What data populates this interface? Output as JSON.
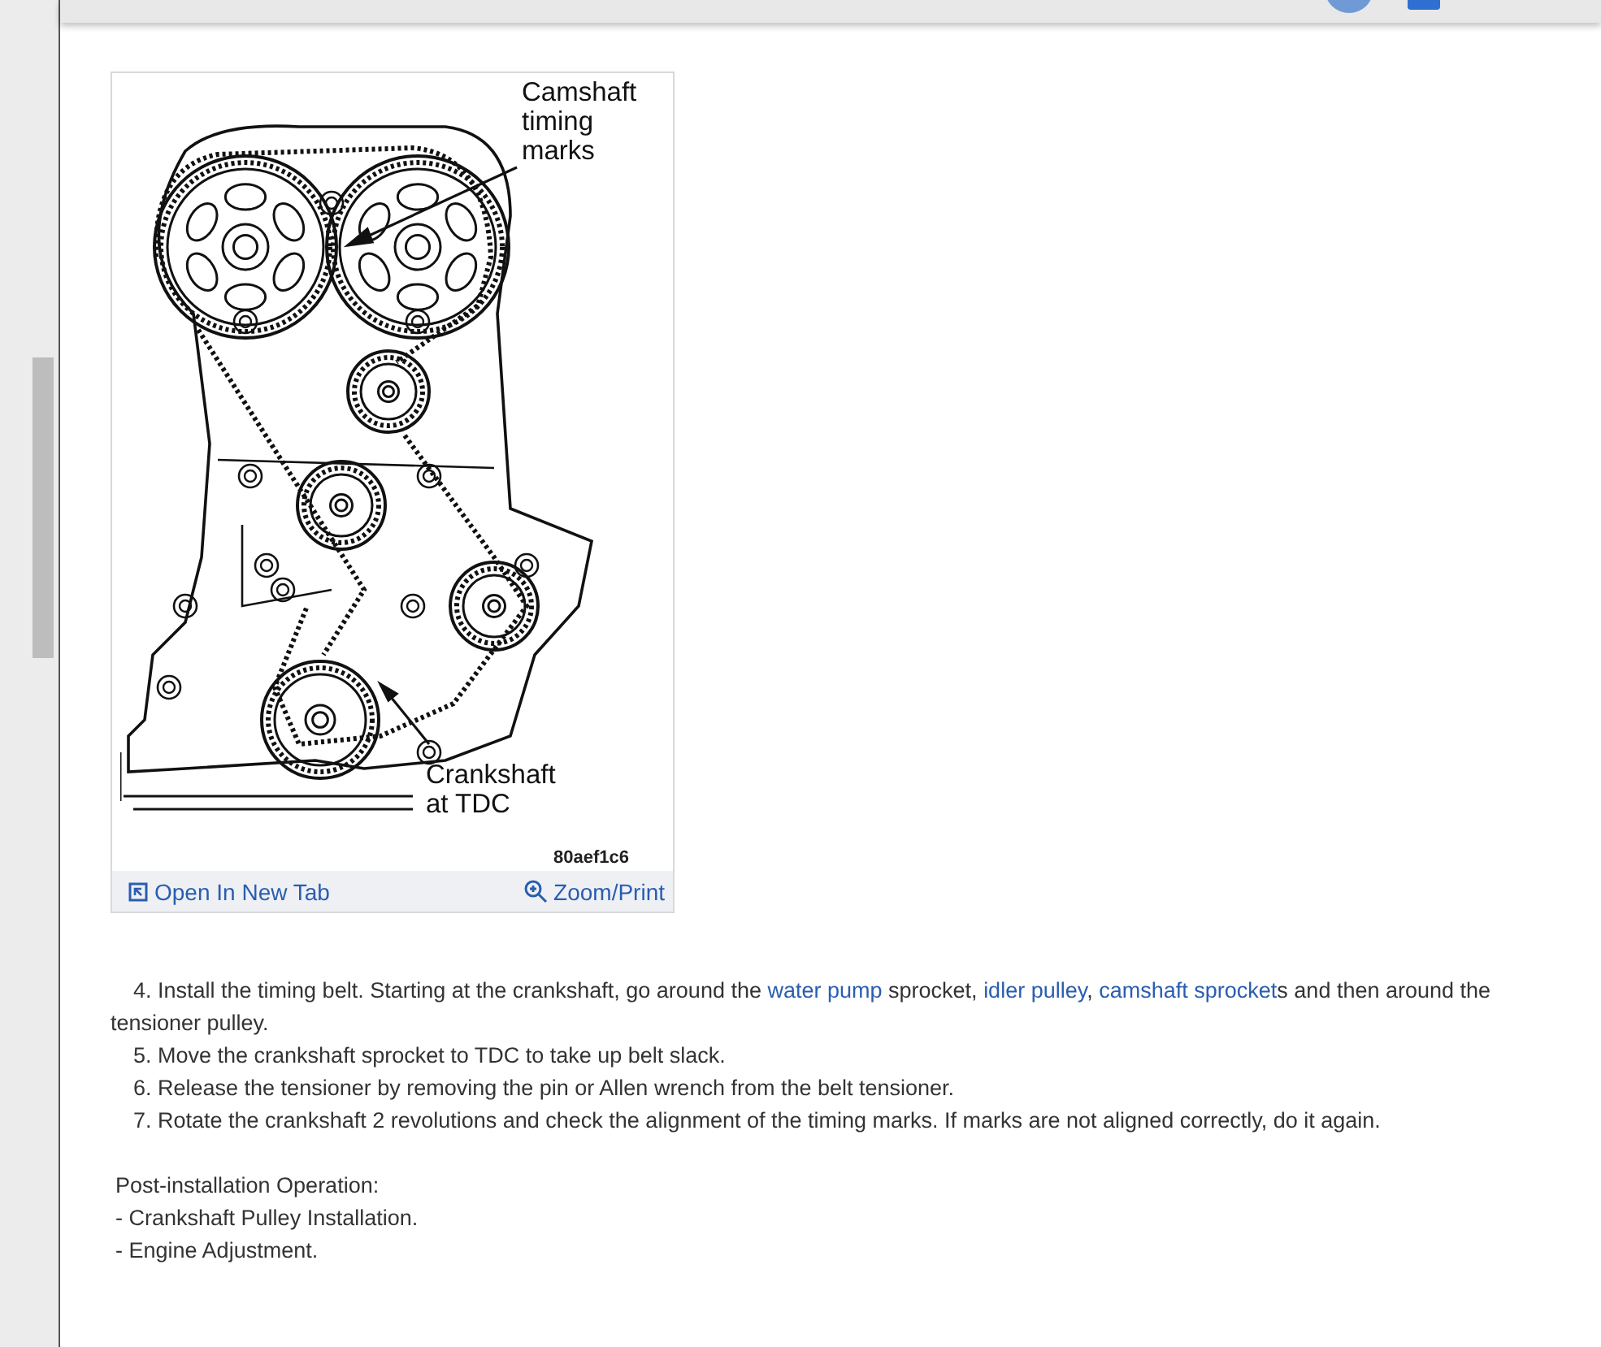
{
  "figure": {
    "labels": [
      {
        "kind": "cam",
        "lines": [
          "Camshaft",
          "timing",
          "marks"
        ]
      },
      {
        "kind": "crank",
        "lines": [
          "Crankshaft",
          "at TDC"
        ]
      }
    ],
    "code": "80aef1c6",
    "actions": [
      {
        "kind": "open",
        "label": "Open In New Tab"
      },
      {
        "kind": "zoom",
        "label": "Zoom/Print"
      }
    ]
  },
  "steps": [
    {
      "text": "4. Install the timing belt. Starting at the crankshaft, go around the ",
      "links": [
        {
          "text": "water pump",
          "after": " sprocket, "
        },
        {
          "text": "idler pulley",
          "after": ", "
        },
        {
          "text": "camshaft sprocket",
          "after": "s and then around the tensioner pulley."
        }
      ]
    },
    {
      "text": "5. Move the crankshaft sprocket to TDC to take up belt slack."
    },
    {
      "text": "6. Release the tensioner by removing the pin or Allen wrench from the belt tensioner."
    },
    {
      "text": "7. Rotate the crankshaft 2 revolutions and check the alignment of the timing marks. If marks are not aligned correctly, do it again."
    }
  ],
  "post": {
    "title": "Post-installation Operation:",
    "items": [
      {
        "bullet": "-",
        "text": "Crankshaft Pulley Installation."
      },
      {
        "bullet": "-",
        "text": "Engine Adjustment."
      }
    ]
  }
}
